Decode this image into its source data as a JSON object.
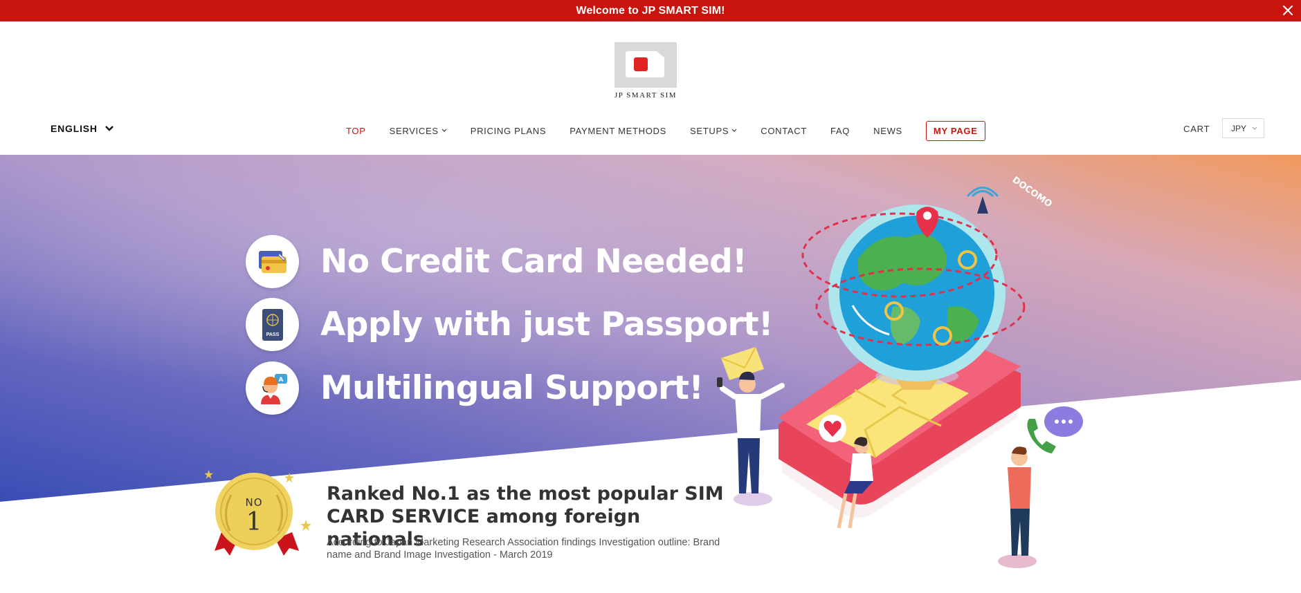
{
  "announcement": {
    "text": "Welcome to JP SMART SIM!",
    "close_icon": "close-icon"
  },
  "header": {
    "brand": "JP SMART SIM",
    "language": "ENGLISH",
    "cart_label": "CART",
    "currency": "JPY"
  },
  "nav": {
    "items": [
      {
        "label": "TOP",
        "active": true,
        "dropdown": false
      },
      {
        "label": "SERVICES",
        "active": false,
        "dropdown": true
      },
      {
        "label": "PRICING PLANS",
        "active": false,
        "dropdown": false
      },
      {
        "label": "PAYMENT METHODS",
        "active": false,
        "dropdown": false
      },
      {
        "label": "SETUPS",
        "active": false,
        "dropdown": true
      },
      {
        "label": "CONTACT",
        "active": false,
        "dropdown": false
      },
      {
        "label": "FAQ",
        "active": false,
        "dropdown": false
      },
      {
        "label": "NEWS",
        "active": false,
        "dropdown": false
      }
    ],
    "my_page": "MY PAGE"
  },
  "hero": {
    "features": [
      {
        "text": "No Credit Card Needed!",
        "icon": "credit-card-icon"
      },
      {
        "text": "Apply with just Passport!",
        "icon": "passport-icon"
      },
      {
        "text": "Multilingual Support!",
        "icon": "support-agent-icon"
      }
    ],
    "award": {
      "line1": "NO",
      "line2": "1"
    },
    "passport_label": "PASS",
    "operator_label": "DOCOMO",
    "ranking_title": "Ranked No.1 as the most popular SIM CARD SERVICE among foreign nationals",
    "ranking_note": "According to Japan Marketing Research Association findings Investigation outline: Brand name and Brand Image Investigation - March 2019"
  },
  "colors": {
    "brand_red": "#c8140d",
    "hero_blue": "#3b55b8",
    "hero_purple": "#9a86c8",
    "hero_peach": "#f0a070"
  }
}
